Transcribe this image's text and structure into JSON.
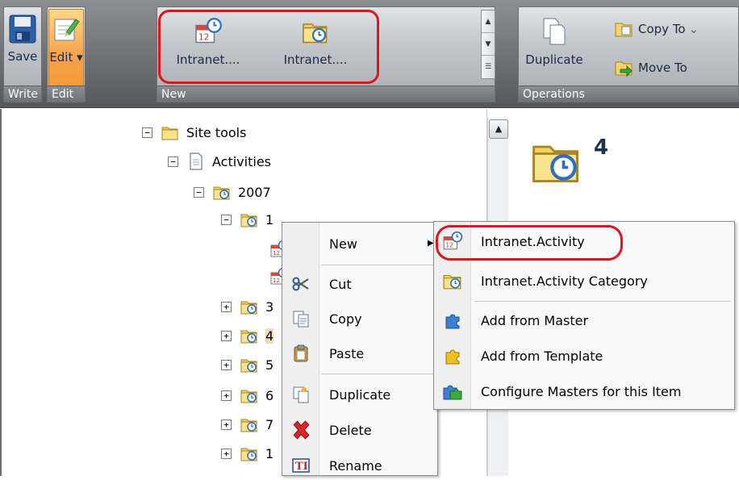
{
  "ribbon": {
    "write_group": {
      "footer": "Write",
      "save_label": "Save"
    },
    "edit_group": {
      "footer": "Edit",
      "edit_label": "Edit",
      "edit_caret": "▾"
    },
    "new_group": {
      "footer": "New",
      "item1_label": "Intranet....",
      "item2_label": "Intranet...."
    },
    "operations_group": {
      "footer": "Operations",
      "duplicate_label": "Duplicate",
      "copy_to_label": "Copy To",
      "move_to_label": "Move To"
    }
  },
  "tree": {
    "items": [
      {
        "label": "Site tools",
        "expander": "⊟"
      },
      {
        "label": "Activities",
        "expander": "⊟"
      },
      {
        "label": "2007",
        "expander": "⊟"
      },
      {
        "label": "1",
        "expander": "⊟"
      },
      {
        "label": "3",
        "expander": "⊞"
      },
      {
        "label": "4",
        "expander": "⊞"
      },
      {
        "label": "5",
        "expander": "⊞"
      },
      {
        "label": "6",
        "expander": "⊞"
      },
      {
        "label": "7",
        "expander": "⊞"
      },
      {
        "label": "1",
        "expander": "⊞"
      }
    ]
  },
  "right_pane": {
    "title": "4"
  },
  "context_menu": {
    "new_label": "New",
    "cut_label": "Cut",
    "copy_label": "Copy",
    "paste_label": "Paste",
    "duplicate_label": "Duplicate",
    "delete_label": "Delete",
    "rename_label": "Rename"
  },
  "submenu": {
    "items": [
      {
        "label": "Intranet.Activity",
        "icon": "calendar-clock-icon"
      },
      {
        "label": "Intranet.Activity Category",
        "icon": "folder-clock-icon"
      },
      {
        "label": "Add from Master",
        "icon": "puzzle-blue-icon"
      },
      {
        "label": "Add from Template",
        "icon": "puzzle-yellow-icon"
      },
      {
        "label": "Configure Masters for this Item",
        "icon": "puzzle-green-icon"
      }
    ]
  },
  "colors": {
    "highlight_ring": "#e0151c",
    "edit_active": "#f7a24b",
    "ribbon_dark": "#55585c"
  }
}
